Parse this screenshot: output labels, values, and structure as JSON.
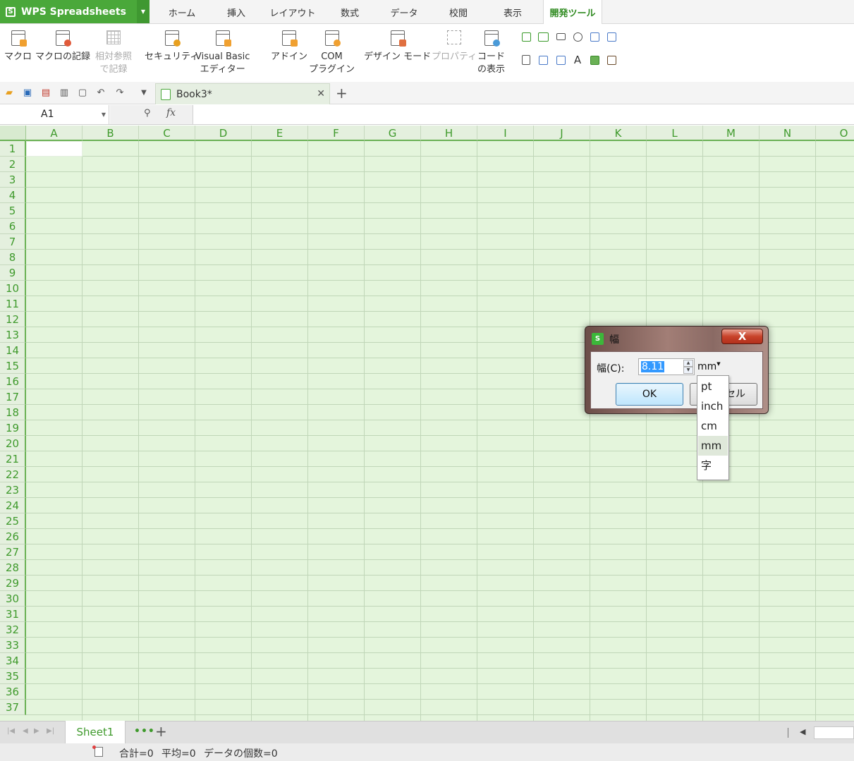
{
  "app": {
    "name": "WPS Spreadsheets",
    "logo_glyph": "S",
    "accent": "#4aa83a"
  },
  "menu": {
    "tabs": [
      "ホーム",
      "挿入",
      "レイアウト",
      "数式",
      "データ",
      "校閲",
      "表示",
      "開発ツール"
    ],
    "active_tab": "開発ツール"
  },
  "ribbon": {
    "macro": "マクロ",
    "record_macro": "マクロの記録",
    "relative_ref_1": "相対参照",
    "relative_ref_2": "で記録",
    "security": "セキュリティ",
    "vba_1": "Visual Basic",
    "vba_2": "エディター",
    "addin": "アドイン",
    "com_1": "COM",
    "com_2": "プラグイン",
    "design_mode": "デザイン モード",
    "properties": "プロパティ",
    "view_code_1": "コード",
    "view_code_2": "の表示"
  },
  "document": {
    "tab_title": "Book3*"
  },
  "formula_bar": {
    "cell_ref": "A1",
    "fx": "fx",
    "content": ""
  },
  "grid": {
    "columns": [
      "A",
      "B",
      "C",
      "D",
      "E",
      "F",
      "G",
      "H",
      "I",
      "J",
      "K",
      "L",
      "M",
      "N",
      "O"
    ],
    "rows": [
      "1",
      "2",
      "3",
      "4",
      "5",
      "6",
      "7",
      "8",
      "9",
      "10",
      "11",
      "12",
      "13",
      "14",
      "15",
      "16",
      "17",
      "18",
      "19",
      "20",
      "21",
      "22",
      "23",
      "24",
      "25",
      "26",
      "27",
      "28",
      "29",
      "30",
      "31",
      "32",
      "33",
      "34",
      "35",
      "36",
      "37"
    ]
  },
  "sheets": {
    "active": "Sheet1",
    "more": "•••",
    "add": "+"
  },
  "status": {
    "sum": "合計=0",
    "average": "平均=0",
    "count": "データの個数=0"
  },
  "dialog": {
    "title": "幅",
    "field_label": "幅(C):",
    "value": "8.11",
    "unit": "mm",
    "ok": "OK",
    "cancel_visible": "セル",
    "close": "X",
    "unit_options": [
      "pt",
      "inch",
      "cm",
      "mm",
      "字"
    ],
    "selected_unit": "mm"
  }
}
